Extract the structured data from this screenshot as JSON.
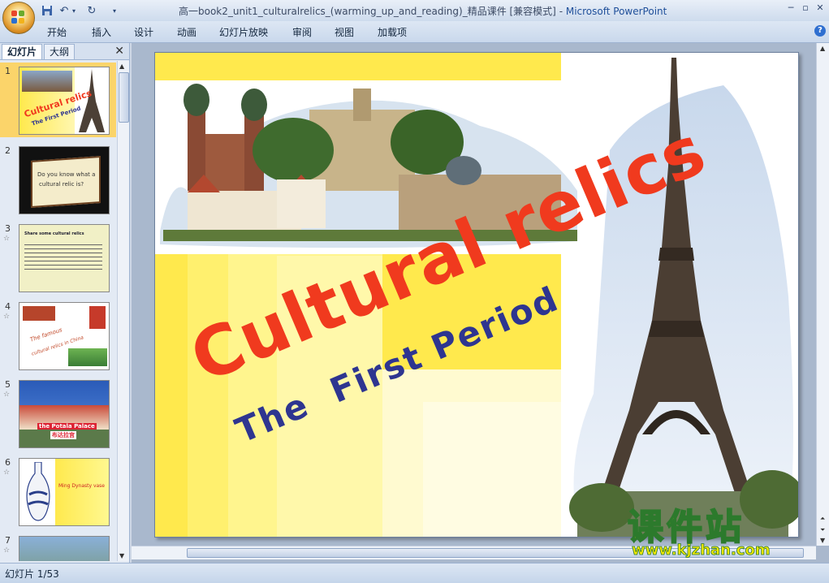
{
  "window": {
    "title_doc": "高一book2_unit1_culturalrelics_(warming_up_and_reading)_精品课件 [兼容模式]",
    "title_sep": " - ",
    "title_app": "Microsoft PowerPoint"
  },
  "ribbon": {
    "tabs": [
      "开始",
      "插入",
      "设计",
      "动画",
      "幻灯片放映",
      "审阅",
      "视图",
      "加载项"
    ]
  },
  "panel": {
    "tab_slides": "幻灯片",
    "tab_outline": "大纲",
    "close": "✕",
    "slides": [
      {
        "num": "1",
        "t1": "Cultural relics",
        "t2": "The First Period"
      },
      {
        "num": "2",
        "t1": "Do you know what a",
        "t2": "cultural relic is?"
      },
      {
        "num": "3",
        "t1": "Share some cultural relics",
        "t2": ""
      },
      {
        "num": "4",
        "t1": "The famous",
        "t2": "cultural relics in China"
      },
      {
        "num": "5",
        "t1": "the Potala Palace",
        "t2": "布达拉宫"
      },
      {
        "num": "6",
        "t1": "Ming Dynasty vase",
        "t2": ""
      },
      {
        "num": "7",
        "t1": "",
        "t2": ""
      }
    ]
  },
  "slide": {
    "title": "Cultural relics",
    "subtitle": "The  First Period"
  },
  "watermark": {
    "cn": "课件站",
    "url": "www.kjzhan.com"
  },
  "status": {
    "text": "幻灯片 1/53"
  },
  "colors": {
    "title_red": "#f03a1e",
    "subtitle_blue": "#2e3590",
    "slide_yellow": "#ffe94d"
  }
}
